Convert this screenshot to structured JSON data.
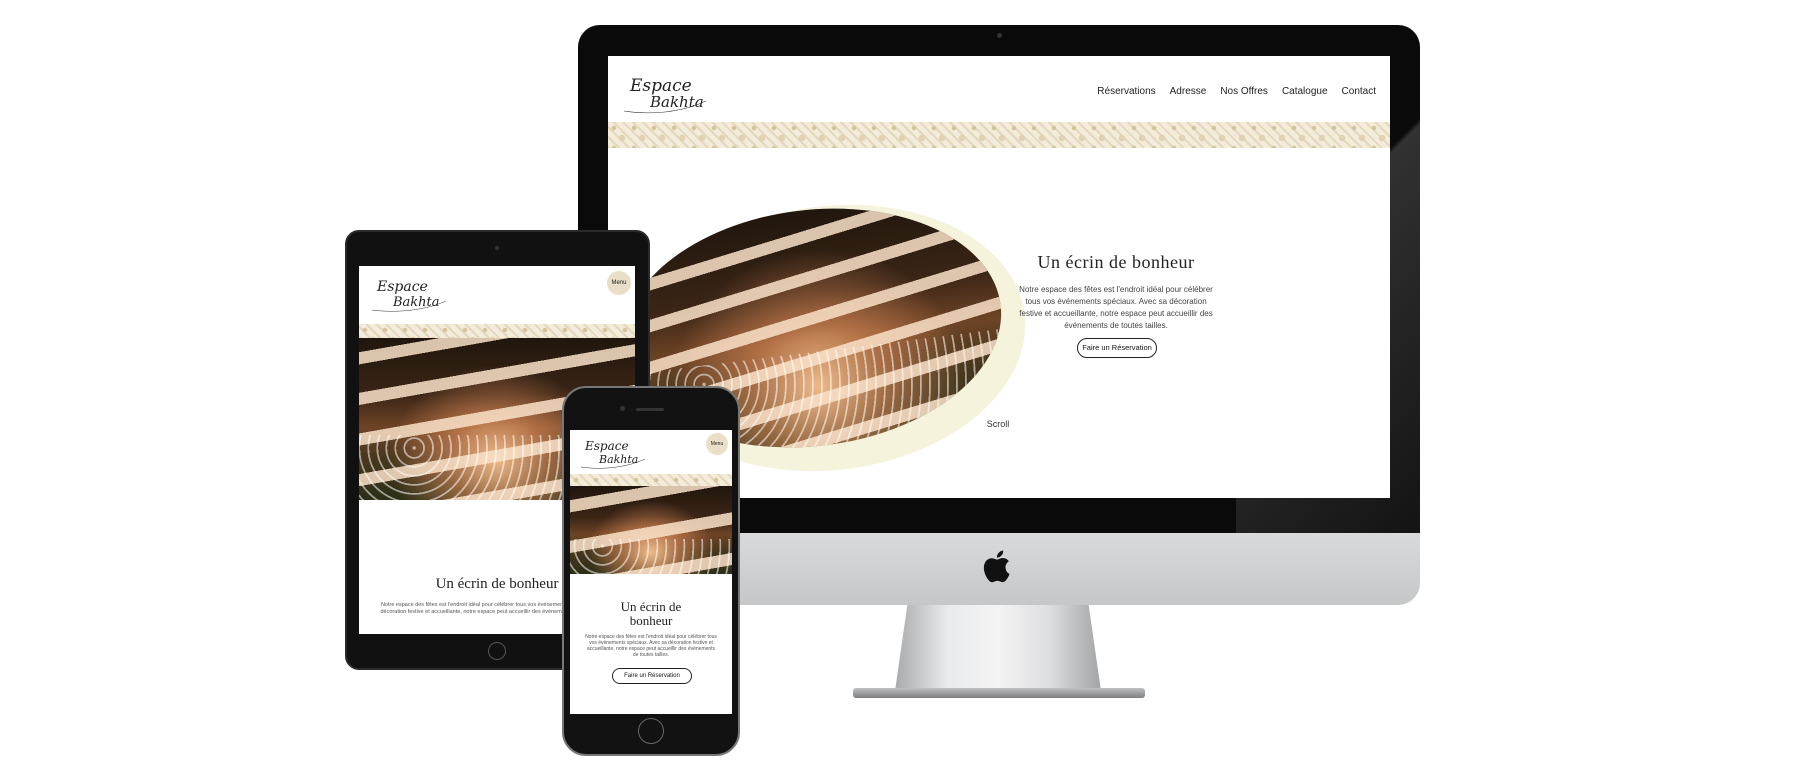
{
  "site": {
    "logo_line1": "Espace",
    "logo_line2": "Bakhta"
  },
  "desktop": {
    "nav": [
      "Réservations",
      "Adresse",
      "Nos Offres",
      "Catalogue",
      "Contact"
    ],
    "hero_title": "Un écrin de bonheur",
    "hero_text": "Notre espace des fêtes est l'endroit idéal pour célébrer tous vos événements spéciaux. Avec sa décoration festive et accueillante, notre espace peut accueillir des événements de toutes tailles.",
    "cta_label": "Faire un Réservation",
    "scroll_label": "Scroll"
  },
  "tablet": {
    "menu_label": "Menu",
    "hero_title": "Un écrin de bonheur",
    "hero_text": "Notre espace des fêtes est l'endroit idéal pour célébrer tous vos événements spéciaux. Avec sa décoration festive et accueillante, notre espace peut accueillir des événements de toutes tailles."
  },
  "phone": {
    "menu_label": "Menu",
    "hero_title_line1": "Un écrin de",
    "hero_title_line2": "bonheur",
    "hero_text": "Notre espace des fêtes est l'endroit idéal pour célébrer tous vos événements spéciaux. Avec sa décoration festive et accueillante, notre espace peut accueillir des événements de toutes tailles.",
    "cta_label": "Faire un Réservation"
  },
  "colors": {
    "accent_beige": "#e9dfc6",
    "lace_gold": "#d5c39c",
    "ellipse_cream": "#f6f3dc",
    "device_black": "#0a0a0a"
  },
  "icons": {
    "brand_mark": "apple-logo-icon"
  }
}
